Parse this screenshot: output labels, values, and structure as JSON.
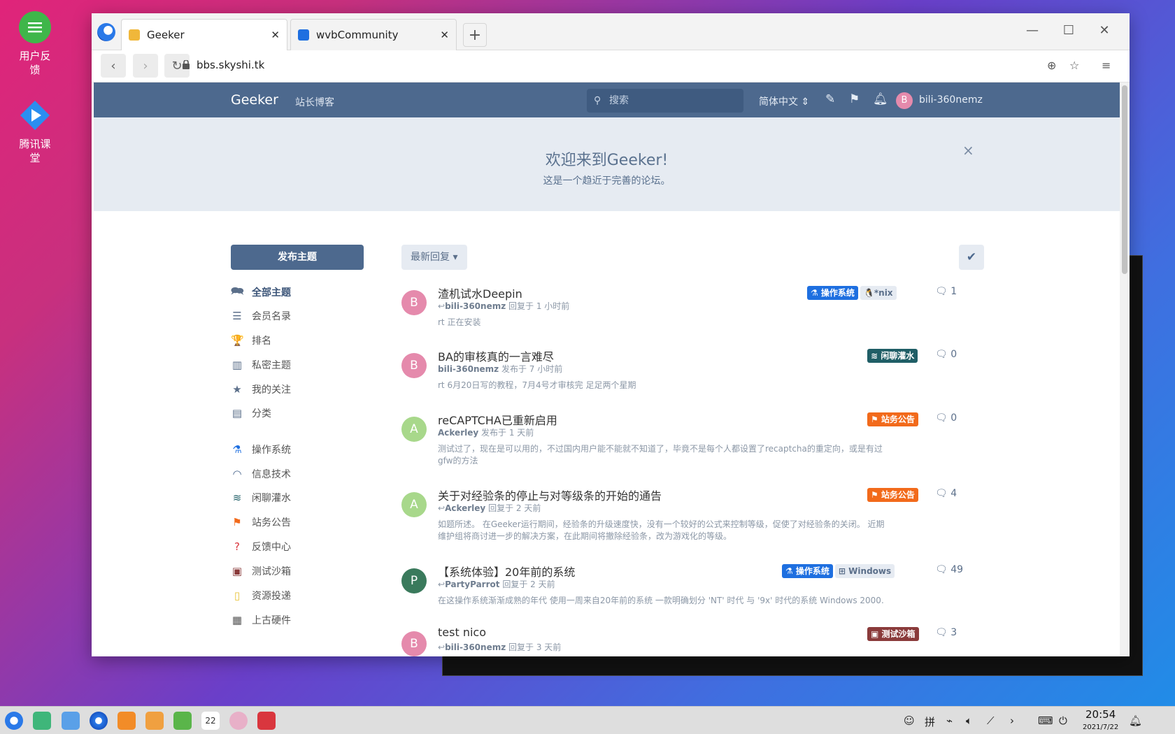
{
  "desktop": {
    "icons": [
      {
        "label_line1": "用户反",
        "label_line2": "馈",
        "icon": "feedback-icon",
        "color": "#3fb64a"
      },
      {
        "label_line1": "腾讯课",
        "label_line2": "堂",
        "icon": "tencent-classroom-icon",
        "color": "#2a8ef0"
      }
    ]
  },
  "browser": {
    "tabs": [
      {
        "label": "Geeker",
        "close": "✕",
        "active": true
      },
      {
        "label": "wvbCommunity",
        "close": "✕",
        "active": false
      }
    ],
    "new_tab": "+",
    "url": "bbs.skyshi.tk",
    "window_controls": {
      "minimize": "—",
      "maximize": "☐",
      "close": "✕"
    }
  },
  "site": {
    "title": "Geeker",
    "link": "站长博客",
    "search_placeholder": "搜索",
    "language": "简体中文 ⇕",
    "user_initial": "B",
    "username": "bili-360nemz",
    "hero_title": "欢迎来到Geeker!",
    "hero_subtitle": "这是一个趋近于完善的论坛。",
    "hero_close": "×",
    "new_post": "发布主题",
    "sort": "最新回复 ▾",
    "nav": [
      {
        "label": "全部主题",
        "icon": "discussions-icon",
        "glyph": "🗪",
        "active": true
      },
      {
        "label": "会员名录",
        "icon": "members-icon",
        "glyph": "☰"
      },
      {
        "label": "排名",
        "icon": "trophy-icon",
        "glyph": "🏆"
      },
      {
        "label": "私密主题",
        "icon": "map-icon",
        "glyph": "▥"
      },
      {
        "label": "我的关注",
        "icon": "star-icon",
        "glyph": "★"
      },
      {
        "label": "分类",
        "icon": "list-icon",
        "glyph": "▤"
      }
    ],
    "categories": [
      {
        "label": "操作系统",
        "icon": "flask-icon",
        "glyph": "⚗",
        "color": "#1e6fe0"
      },
      {
        "label": "信息技术",
        "icon": "wifi-icon",
        "glyph": "◠",
        "color": "#4d698e"
      },
      {
        "label": "闲聊灌水",
        "icon": "water-icon",
        "glyph": "≋",
        "color": "#1f5e66"
      },
      {
        "label": "站务公告",
        "icon": "flag-icon",
        "glyph": "⚑",
        "color": "#f26a1b"
      },
      {
        "label": "反馈中心",
        "icon": "question-icon",
        "glyph": "?",
        "color": "#d9363e"
      },
      {
        "label": "测试沙箱",
        "icon": "box-icon",
        "glyph": "▣",
        "color": "#8a3b3b"
      },
      {
        "label": "资源投递",
        "icon": "file-icon",
        "glyph": "▯",
        "color": "#e8c33a"
      },
      {
        "label": "上古硬件",
        "icon": "chip-icon",
        "glyph": "▦",
        "color": "#555"
      }
    ],
    "discussions": [
      {
        "initial": "B",
        "avatar_color": "#e58aac",
        "title": "渣机试水Deepin",
        "user": "bili-360nemz",
        "action": "回复于 1 小时前",
        "reply_arrow": "↩",
        "excerpt": "rt 正在安装",
        "tags": [
          {
            "label": "⚗ 操作系统",
            "color": "#1e6fe0"
          },
          {
            "label": "🐧*nix",
            "color": "gray"
          }
        ],
        "replies": "1"
      },
      {
        "initial": "B",
        "avatar_color": "#e58aac",
        "title": "BA的审核真的一言难尽",
        "user": "bili-360nemz",
        "action": "发布于 7 小时前",
        "reply_arrow": "",
        "excerpt": "rt 6月20日写的教程，7月4号才审核完 足足两个星期",
        "tags": [
          {
            "label": "≋ 闲聊灌水",
            "color": "#1f5e66"
          }
        ],
        "replies": "0"
      },
      {
        "initial": "A",
        "avatar_color": "#a8d88b",
        "title": "reCAPTCHA已重新启用",
        "user": "Ackerley",
        "action": "发布于 1 天前",
        "reply_arrow": "",
        "excerpt": "测试过了，现在是可以用的，不过国内用户能不能就不知道了，毕竟不是每个人都设置了recaptcha的重定向，或是有过gfw的方法",
        "tags": [
          {
            "label": "⚑ 站务公告",
            "color": "#f26a1b"
          }
        ],
        "replies": "0"
      },
      {
        "initial": "A",
        "avatar_color": "#a8d88b",
        "title": "关于对经验条的停止与对等级条的开始的通告",
        "user": "Ackerley",
        "action": "回复于 2 天前",
        "reply_arrow": "↩",
        "excerpt": "如题所述。 在Geeker运行期间，经验条的升级速度快，没有一个较好的公式来控制等级，促使了对经验条的关闭。 近期维护组将商讨进一步的解决方案，在此期间将撤除经验条，改为游戏化的等级。",
        "tags": [
          {
            "label": "⚑ 站务公告",
            "color": "#f26a1b"
          }
        ],
        "replies": "4"
      },
      {
        "initial": "P",
        "avatar_color": "#3a7a5c",
        "title": "【系统体验】20年前的系统",
        "user": "PartyParrot",
        "action": "回复于 2 天前",
        "reply_arrow": "↩",
        "excerpt": "在这操作系统渐渐成熟的年代 使用一周来自20年前的系统 一款明确划分 'NT' 时代 与 '9x' 时代的系统 Windows 2000.",
        "tags": [
          {
            "label": "⚗ 操作系统",
            "color": "#1e6fe0"
          },
          {
            "label": "⊞ Windows",
            "color": "gray"
          }
        ],
        "replies": "49"
      },
      {
        "initial": "B",
        "avatar_color": "#e58aac",
        "title": "test nico",
        "user": "bili-360nemz",
        "action": "回复于 3 天前",
        "reply_arrow": "↩",
        "excerpt": "",
        "tags": [
          {
            "label": "▣ 测试沙箱",
            "color": "#8a3b3b"
          }
        ],
        "replies": "3"
      }
    ],
    "reply_icon": "🗨"
  },
  "taskbar": {
    "time": "20:54",
    "date": "2021/7/22",
    "ime": "拼",
    "calendar_day": "22"
  }
}
